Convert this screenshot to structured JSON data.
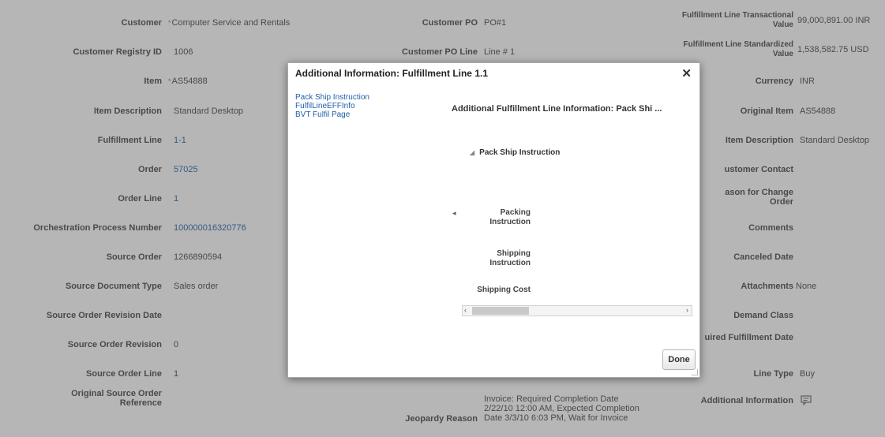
{
  "background": {
    "col1": [
      {
        "label": "Customer",
        "value": "Computer Service and Rentals",
        "required": true
      },
      {
        "label": "Customer Registry ID",
        "value": "1006"
      },
      {
        "label": "Item",
        "value": "AS54888",
        "required": true
      },
      {
        "label": "Item Description",
        "value": "Standard Desktop"
      },
      {
        "label": "Fulfillment Line",
        "value": "1-1",
        "link": true
      },
      {
        "label": "Order",
        "value": "57025",
        "link": true
      },
      {
        "label": "Order Line",
        "value": "1",
        "link": true
      },
      {
        "label": "Orchestration Process Number",
        "value": "100000016320776",
        "link": true
      },
      {
        "label": "Source Order",
        "value": "1266890594"
      },
      {
        "label": "Source Document Type",
        "value": "Sales order"
      },
      {
        "label": "Source Order Revision Date",
        "value": ""
      },
      {
        "label": "Source Order Revision",
        "value": "0"
      },
      {
        "label": "Source Order Line",
        "value": "1"
      },
      {
        "label": "Original Source Order Reference",
        "value": ""
      }
    ],
    "col2": [
      {
        "label": "Customer PO",
        "value": "PO#1"
      },
      {
        "label": "Customer PO Line",
        "value": "Line # 1"
      }
    ],
    "jeopardy_reason": {
      "label": "Jeopardy Reason",
      "value": "Invoice: Required Completion Date 2/22/10 12:00 AM, Expected Completion Date 3/3/10 6:03 PM, Wait for Invoice"
    },
    "col3": [
      {
        "label": "Fulfillment Line Transactional Value",
        "value": "99,000,891.00 INR"
      },
      {
        "label": "Fulfillment Line Standardized Value",
        "value": "1,538,582.75 USD"
      },
      {
        "label": "Currency",
        "value": "INR"
      },
      {
        "label": "Original Item",
        "value": "AS54888"
      },
      {
        "label": "Item Description",
        "value": "Standard Desktop"
      },
      {
        "label": "ustomer Contact",
        "value": ""
      },
      {
        "label": "ason for Change Order",
        "value": ""
      },
      {
        "label": "Comments",
        "value": ""
      },
      {
        "label": "Canceled Date",
        "value": ""
      },
      {
        "label": "Attachments",
        "value": "None"
      },
      {
        "label": "Demand Class",
        "value": ""
      },
      {
        "label": "uired Fulfillment Date",
        "value": ""
      },
      {
        "label": "Line Type",
        "value": "Buy"
      },
      {
        "label": "Additional Information",
        "value": ""
      }
    ],
    "additional_info_icon": "comment-icon"
  },
  "dialog": {
    "title": "Additional Information: Fulfillment Line 1.1",
    "close_icon": "close-icon",
    "nav_links": [
      "Pack Ship Instruction",
      "FulfilLineEFFInfo",
      "BVT Fulfil Page"
    ],
    "section_title": "Additional Fulfillment Line Information: Pack Shi ...",
    "disclosure_label": "Pack Ship Instruction",
    "fields": [
      {
        "label": "Packing Instruction"
      },
      {
        "label": "Shipping Instruction"
      },
      {
        "label": "Shipping Cost"
      }
    ],
    "done_label": "Done"
  }
}
